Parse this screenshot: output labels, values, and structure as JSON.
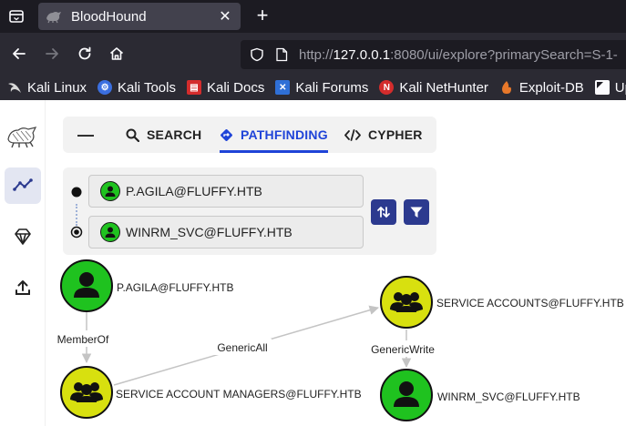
{
  "browser": {
    "tab_title": "BloodHound",
    "tab_close_glyph": "✕",
    "new_tab_glyph": "+",
    "url": {
      "prefix": "http://",
      "host": "127.0.0.1",
      "rest": ":8080/ui/explore?primarySearch=S-1-"
    },
    "bookmarks": [
      {
        "label": "Kali Linux",
        "icon": "kali-dragon-icon",
        "color": "#cccccc"
      },
      {
        "label": "Kali Tools",
        "icon": "kali-tools-icon",
        "color": "#3b6fe0"
      },
      {
        "label": "Kali Docs",
        "icon": "kali-docs-icon",
        "color": "#d42c2c"
      },
      {
        "label": "Kali Forums",
        "icon": "kali-forums-icon",
        "color": "#2f6fd6"
      },
      {
        "label": "Kali NetHunter",
        "icon": "nethunter-icon",
        "color": "#d42c2c"
      },
      {
        "label": "Exploit-DB",
        "icon": "exploit-db-icon",
        "color": "#e8782a"
      },
      {
        "label": "Updat",
        "icon": "update-icon",
        "color": "#ffffff"
      }
    ]
  },
  "app": {
    "left_nav": [
      {
        "name": "bloodhound-logo-icon",
        "active": false
      },
      {
        "name": "explore-icon",
        "active": true
      },
      {
        "name": "diamond-icon",
        "active": false
      },
      {
        "name": "upload-icon",
        "active": false
      }
    ],
    "search_tabs": {
      "collapse_glyph": "—",
      "search_label": "SEARCH",
      "pathfinding_label": "PATHFINDING",
      "cypher_label": "CYPHER",
      "active": "pathfinding"
    },
    "pathfinding": {
      "start_node": "P.AGILA@FLUFFY.HTB",
      "end_node": "WINRM_SVC@FLUFFY.HTB"
    },
    "colors": {
      "accent": "#1f44d8",
      "user_node": "#1fc21f",
      "group_node": "#d8e00f",
      "button": "#2c3a8f"
    },
    "graph": {
      "nodes": [
        {
          "id": "n1",
          "label": "P.AGILA@FLUFFY.HTB",
          "kind": "user"
        },
        {
          "id": "n2",
          "label": "SERVICE ACCOUNT MANAGERS@FLUFFY.HTB",
          "kind": "group"
        },
        {
          "id": "n3",
          "label": "SERVICE ACCOUNTS@FLUFFY.HTB",
          "kind": "group"
        },
        {
          "id": "n4",
          "label": "WINRM_SVC@FLUFFY.HTB",
          "kind": "user"
        }
      ],
      "edges": [
        {
          "label": "MemberOf",
          "from": "n1",
          "to": "n2"
        },
        {
          "label": "GenericAll",
          "from": "n2",
          "to": "n3"
        },
        {
          "label": "GenericWrite",
          "from": "n3",
          "to": "n4"
        }
      ]
    }
  }
}
